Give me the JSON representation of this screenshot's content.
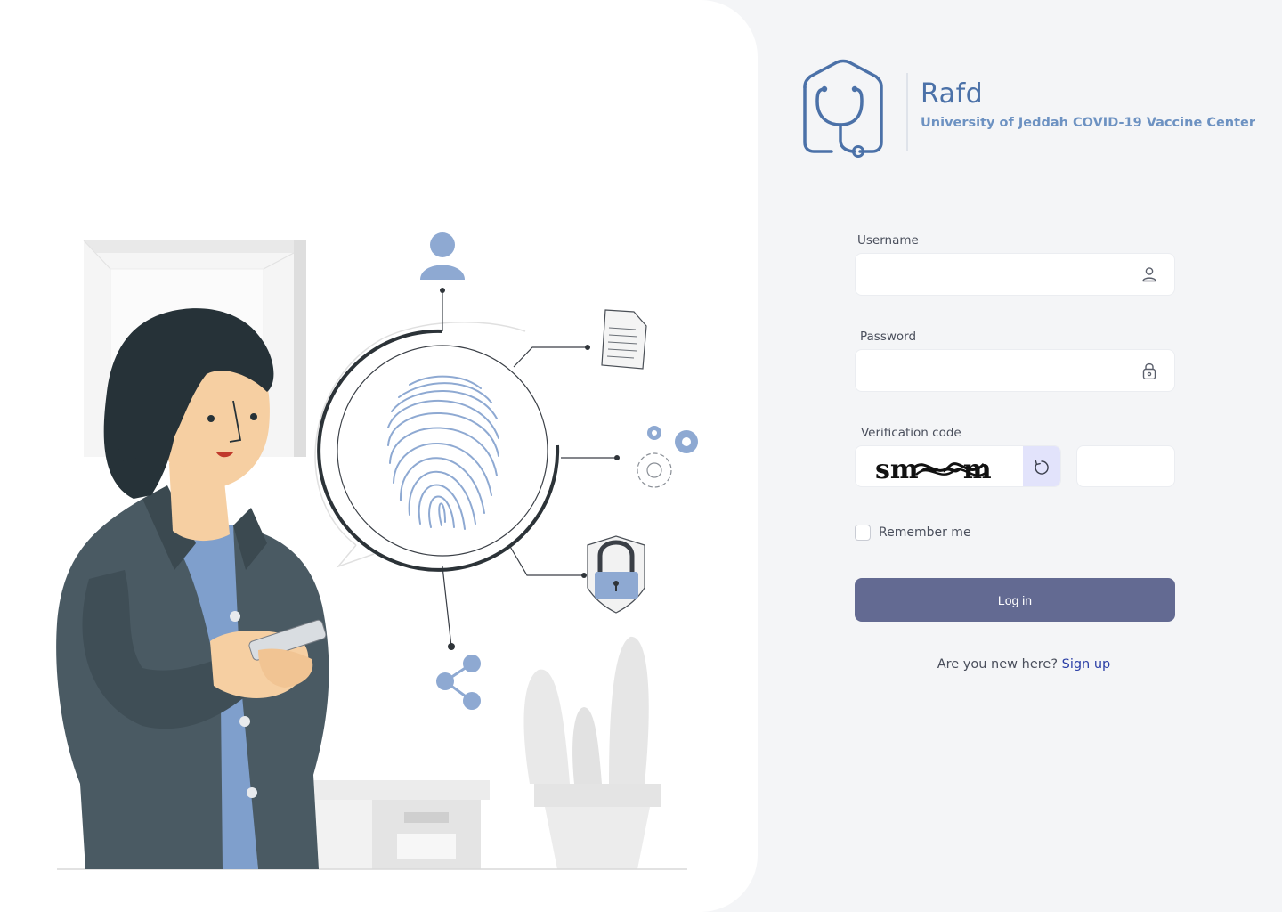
{
  "brand": {
    "name": "Rafd",
    "subtitle": "University of Jeddah COVID-19 Vaccine Center"
  },
  "form": {
    "username_label": "Username",
    "username_value": "",
    "password_label": "Password",
    "password_value": "",
    "verification_label": "Verification code",
    "captcha_text": "sm~~m",
    "verification_value": "",
    "remember_label": "Remember me",
    "remember_checked": false,
    "login_label": "Log in"
  },
  "signup": {
    "prompt": "Are you new here?",
    "link_label": "Sign up"
  },
  "colors": {
    "accent": "#636a92",
    "brand_blue": "#4b71a8",
    "link": "#2b3fa6",
    "illustration_blue": "#8fa9d0",
    "jacket": "#4a5a63"
  },
  "icons": [
    "user-icon",
    "lock-icon",
    "refresh-icon",
    "stethoscope-house-logo"
  ]
}
